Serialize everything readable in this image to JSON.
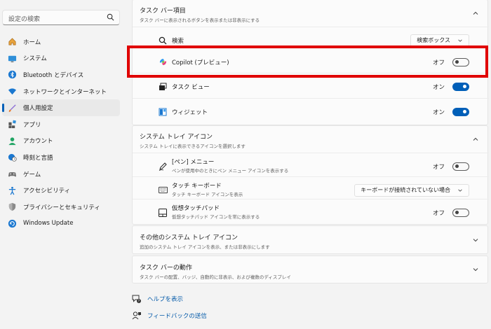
{
  "sidebar": {
    "search_placeholder": "設定の検索",
    "items": [
      {
        "label": "ホーム"
      },
      {
        "label": "システム"
      },
      {
        "label": "Bluetooth とデバイス"
      },
      {
        "label": "ネットワークとインターネット"
      },
      {
        "label": "個人用設定"
      },
      {
        "label": "アプリ"
      },
      {
        "label": "アカウント"
      },
      {
        "label": "時刻と言語"
      },
      {
        "label": "ゲーム"
      },
      {
        "label": "アクセシビリティ"
      },
      {
        "label": "プライバシーとセキュリティ"
      },
      {
        "label": "Windows Update"
      }
    ],
    "active_index": 4
  },
  "taskbar_items": {
    "title": "タスク バー項目",
    "subtitle": "タスク バーに表示されるボタンを表示または非表示にする",
    "search": {
      "label": "検索",
      "value": "検索ボックス"
    },
    "copilot": {
      "label": "Copilot (プレビュー)",
      "state": "オフ"
    },
    "taskview": {
      "label": "タスク ビュー",
      "state": "オン"
    },
    "widgets": {
      "label": "ウィジェット",
      "state": "オン"
    }
  },
  "systray": {
    "title": "システム トレイ アイコン",
    "subtitle": "システム トレイに表示できるアイコンを選択します",
    "pen": {
      "label": "[ペン] メニュー",
      "sub": "ペンが使用中のときにペン メニュー アイコンを表示する",
      "state": "オフ"
    },
    "touch": {
      "label": "タッチ キーボード",
      "sub": "タッチ キーボード アイコンを表示",
      "value": "キーボードが接続されていない場合"
    },
    "touchpad": {
      "label": "仮想タッチパッド",
      "sub": "仮想タッチパッド アイコンを常に表示する",
      "state": "オフ"
    }
  },
  "other_tray": {
    "title": "その他のシステム トレイ アイコン",
    "subtitle": "追加のシステム トレイ アイコンを表示、または非表示にします"
  },
  "behavior": {
    "title": "タスク バーの動作",
    "subtitle": "タスク バーの配置、バッジ、自動的に非表示、および複数のディスプレイ"
  },
  "links": {
    "help": "ヘルプを表示",
    "feedback": "フィードバックの送信"
  },
  "colors": {
    "accent": "#005fb8",
    "highlight": "#e00000"
  }
}
